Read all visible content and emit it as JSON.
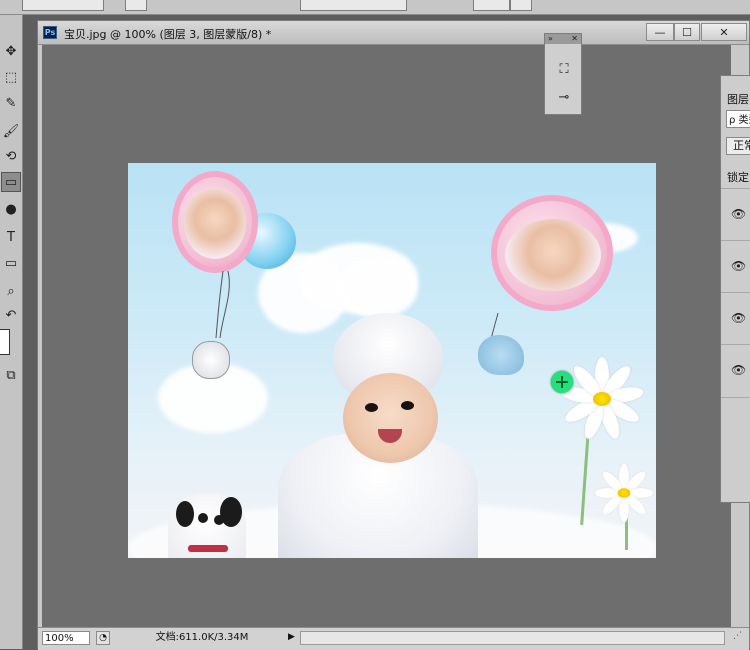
{
  "document": {
    "title": "宝贝.jpg @ 100% (图层 3, 图层蒙版/8) *",
    "app_icon": "Ps",
    "window_controls": {
      "minimize": "—",
      "maximize": "☐",
      "close": "✕"
    }
  },
  "status_bar": {
    "zoom": "100%",
    "doc_info": "文档:611.0K/3.34M",
    "arrow": "▶"
  },
  "tools": [
    {
      "name": "move-tool",
      "glyph": "✥"
    },
    {
      "name": "marquee-tool",
      "glyph": "⬚"
    },
    {
      "name": "eyedropper-tool",
      "glyph": "✎"
    },
    {
      "name": "brush-tool",
      "glyph": "🖌"
    },
    {
      "name": "history-brush-tool",
      "glyph": "⟲"
    },
    {
      "name": "gradient-tool",
      "glyph": "▭"
    },
    {
      "name": "blur-tool",
      "glyph": "●"
    },
    {
      "name": "type-tool",
      "glyph": "T"
    },
    {
      "name": "rectangle-tool",
      "glyph": "▭"
    },
    {
      "name": "zoom-tool",
      "glyph": "⌕"
    },
    {
      "name": "rotate-view-tool",
      "glyph": "↶"
    },
    {
      "name": "screen-mode-tool",
      "glyph": "⧉"
    }
  ],
  "mini_panel": {
    "collapse": "»",
    "close": "✕",
    "brush_preset_icon": "brush-preset-icon",
    "clone_source_icon": "clone-source-icon"
  },
  "layers_panel": {
    "tab_label": "图层",
    "search_placeholder": "ρ 类型",
    "blend_mode": "正常",
    "lock_label": "锁定",
    "visibility_glyph": "👁",
    "row_count_visible": 4
  }
}
